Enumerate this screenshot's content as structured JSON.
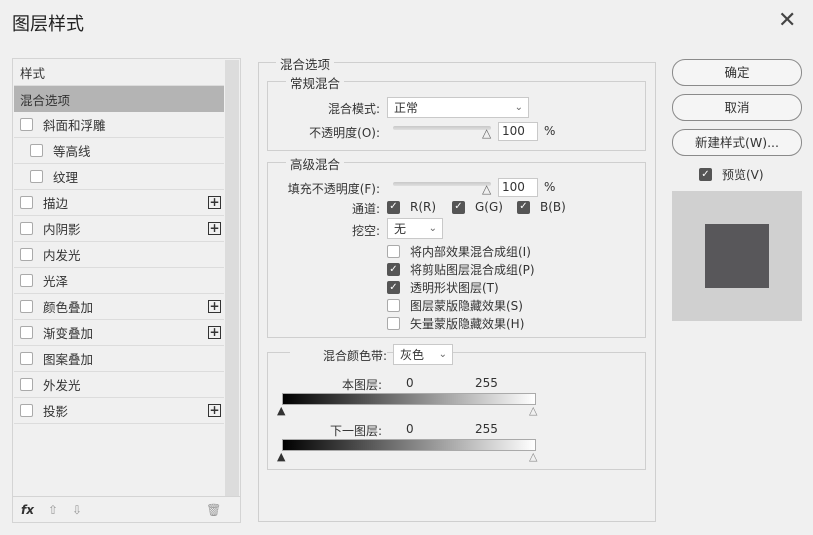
{
  "title": "图层样式",
  "sidebar": {
    "header": "样式",
    "items": [
      {
        "label": "混合选项",
        "selected": true,
        "checkbox": false,
        "plus": false,
        "indent": false
      },
      {
        "label": "斜面和浮雕",
        "checkbox": true,
        "plus": false,
        "indent": false
      },
      {
        "label": "等高线",
        "checkbox": true,
        "plus": false,
        "indent": true
      },
      {
        "label": "纹理",
        "checkbox": true,
        "plus": false,
        "indent": true
      },
      {
        "label": "描边",
        "checkbox": true,
        "plus": true,
        "indent": false
      },
      {
        "label": "内阴影",
        "checkbox": true,
        "plus": true,
        "indent": false
      },
      {
        "label": "内发光",
        "checkbox": true,
        "plus": false,
        "indent": false
      },
      {
        "label": "光泽",
        "checkbox": true,
        "plus": false,
        "indent": false
      },
      {
        "label": "颜色叠加",
        "checkbox": true,
        "plus": true,
        "indent": false
      },
      {
        "label": "渐变叠加",
        "checkbox": true,
        "plus": true,
        "indent": false
      },
      {
        "label": "图案叠加",
        "checkbox": true,
        "plus": false,
        "indent": false
      },
      {
        "label": "外发光",
        "checkbox": true,
        "plus": false,
        "indent": false
      },
      {
        "label": "投影",
        "checkbox": true,
        "plus": true,
        "indent": false
      }
    ],
    "fx_label": "fx"
  },
  "main": {
    "section_title": "混合选项",
    "general": {
      "title": "常规混合",
      "mode_label": "混合模式:",
      "mode_value": "正常",
      "opacity_label": "不透明度(O):",
      "opacity_value": "100",
      "pct": "%"
    },
    "advanced": {
      "title": "高级混合",
      "fill_label": "填充不透明度(F):",
      "fill_value": "100",
      "pct": "%",
      "channels_label": "通道:",
      "channels": [
        "R(R)",
        "G(G)",
        "B(B)"
      ],
      "knockout_label": "挖空:",
      "knockout_value": "无",
      "options": [
        {
          "label": "将内部效果混合成组(I)",
          "checked": false
        },
        {
          "label": "将剪贴图层混合成组(P)",
          "checked": true
        },
        {
          "label": "透明形状图层(T)",
          "checked": true
        },
        {
          "label": "图层蒙版隐藏效果(S)",
          "checked": false
        },
        {
          "label": "矢量蒙版隐藏效果(H)",
          "checked": false
        }
      ]
    },
    "blend_if": {
      "label": "混合颜色带:",
      "value": "灰色",
      "this_layer": "本图层:",
      "underlying": "下一图层:",
      "min": "0",
      "max": "255"
    }
  },
  "buttons": {
    "ok": "确定",
    "cancel": "取消",
    "new_style": "新建样式(W)...",
    "preview": "预览(V)"
  },
  "preview_color": "#58575a"
}
